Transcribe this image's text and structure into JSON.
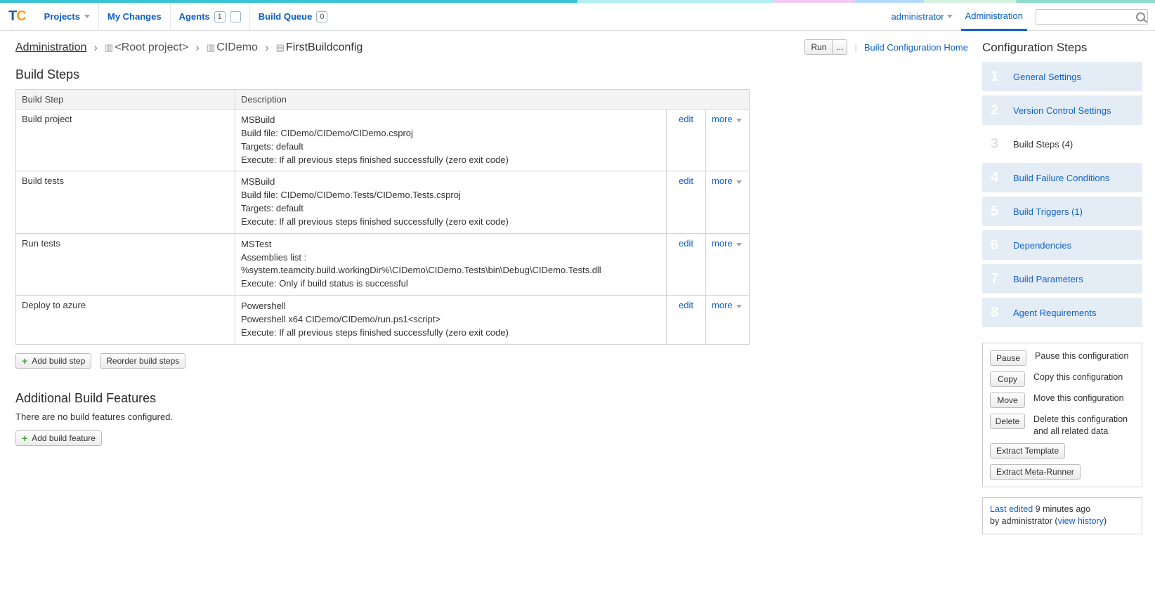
{
  "nav": {
    "projects": "Projects",
    "mychanges": "My Changes",
    "agents": "Agents",
    "agents_count": "1",
    "buildqueue": "Build Queue",
    "buildqueue_count": "0",
    "user": "administrator",
    "admin": "Administration"
  },
  "topactions": {
    "run": "Run",
    "ellipsis": "...",
    "home": "Build Configuration Home"
  },
  "crumbs": {
    "admin": "Administration",
    "root": "<Root project>",
    "proj": "CIDemo",
    "current": "FirstBuildconfig"
  },
  "sections": {
    "buildsteps_title": "Build Steps",
    "features_title": "Additional Build Features",
    "features_empty": "There are no build features configured."
  },
  "table": {
    "col_step": "Build Step",
    "col_desc": "Description",
    "edit": "edit",
    "more": "more",
    "rows": [
      {
        "name": "Build project",
        "lines": [
          "MSBuild",
          "Build file: CIDemo/CIDemo/CIDemo.csproj",
          "Targets: default",
          "Execute: If all previous steps finished successfully (zero exit code)"
        ]
      },
      {
        "name": "Build tests",
        "lines": [
          "MSBuild",
          "Build file: CIDemo/CIDemo.Tests/CIDemo.Tests.csproj",
          "Targets: default",
          "Execute: If all previous steps finished successfully (zero exit code)"
        ]
      },
      {
        "name": "Run tests",
        "lines": [
          "MSTest",
          "Assemblies list : %system.teamcity.build.workingDir%\\CIDemo\\CIDemo.Tests\\bin\\Debug\\CIDemo.Tests.dll",
          "Execute: Only if build status is successful"
        ]
      },
      {
        "name": "Deploy to azure",
        "lines": [
          "Powershell",
          "Powershell x64 CIDemo/CIDemo/run.ps1<script>",
          "Execute: If all previous steps finished successfully (zero exit code)"
        ]
      }
    ]
  },
  "buttons": {
    "add_step": "Add build step",
    "reorder": "Reorder build steps",
    "add_feature": "Add build feature"
  },
  "cfg": {
    "title": "Configuration Steps",
    "items": [
      {
        "n": "1",
        "label": "General Settings"
      },
      {
        "n": "2",
        "label": "Version Control Settings"
      },
      {
        "n": "3",
        "label": "Build Steps (4)"
      },
      {
        "n": "4",
        "label": "Build Failure Conditions"
      },
      {
        "n": "5",
        "label": "Build Triggers (1)"
      },
      {
        "n": "6",
        "label": "Dependencies"
      },
      {
        "n": "7",
        "label": "Build Parameters"
      },
      {
        "n": "8",
        "label": "Agent Requirements"
      }
    ],
    "active_index": 2
  },
  "actbox": {
    "pause_btn": "Pause",
    "pause_lbl": "Pause this configuration",
    "copy_btn": "Copy",
    "copy_lbl": "Copy this configuration",
    "move_btn": "Move",
    "move_lbl": "Move this configuration",
    "del_btn": "Delete",
    "del_lbl": "Delete this configuration and all related data",
    "extract_template": "Extract Template",
    "extract_meta": "Extract Meta-Runner"
  },
  "lastedit": {
    "prefix": "Last edited",
    "time": "9 minutes ago",
    "by": "by administrator (",
    "viewhist": "view history",
    "close": ")"
  }
}
